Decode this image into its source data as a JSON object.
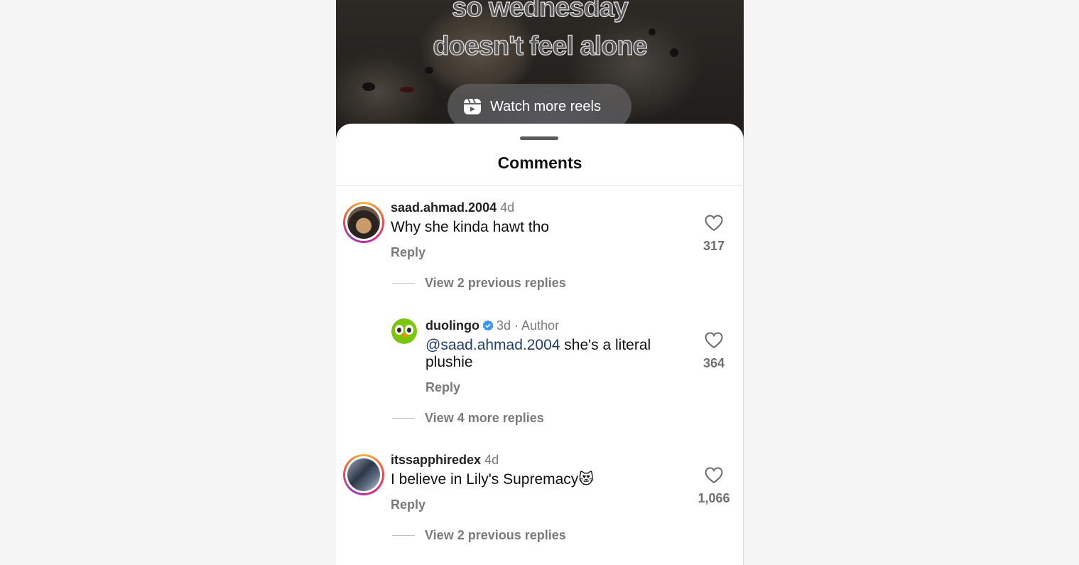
{
  "video": {
    "caption_line1": "so wednesday",
    "caption_line2": "doesn't feel alone",
    "watch_more_label": "Watch more reels"
  },
  "sheet": {
    "title": "Comments"
  },
  "comments": [
    {
      "username": "saad.ahmad.2004",
      "time": "4d",
      "text": "Why she kinda hawt tho",
      "reply_label": "Reply",
      "likes": "317",
      "view_replies": "View 2 previous replies"
    },
    {
      "username": "duolingo",
      "time": "3d",
      "author_tag": "· Author",
      "mention": "@saad.ahmad.2004",
      "text": " she's a literal plushie",
      "reply_label": "Reply",
      "likes": "364",
      "view_replies": "View 4 more replies"
    },
    {
      "username": "itssapphiredex",
      "time": "4d",
      "text": "I believe in Lily's Supremacy😻",
      "reply_label": "Reply",
      "likes": "1,066",
      "view_replies": "View 2 previous replies"
    }
  ],
  "icons": {
    "reel": "reel-icon",
    "heart": "heart-icon",
    "verified": "verified-badge-icon"
  },
  "colors": {
    "verified_blue": "#3897f0",
    "mention": "#1f3e6e",
    "duolingo_green": "#7ac70c"
  }
}
